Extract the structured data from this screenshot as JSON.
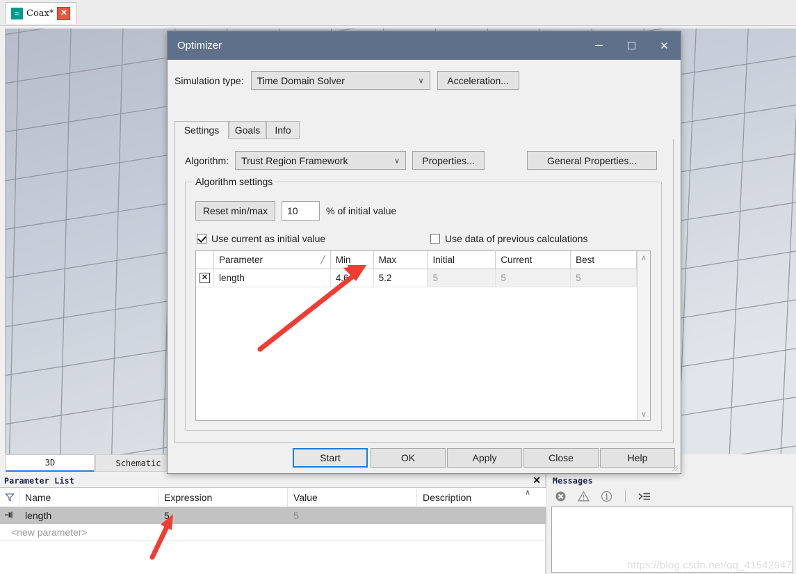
{
  "app": {
    "tab_label": "Coax*",
    "doc_icon": "waves-icon",
    "close_label": "✕"
  },
  "view_tabs": {
    "items": [
      {
        "label": "3D",
        "active": true
      },
      {
        "label": "Schematic",
        "active": false
      }
    ]
  },
  "dialog": {
    "title": "Optimizer",
    "minimize_label": "─",
    "maximize_label": "☐",
    "close_label": "✕",
    "simulation_type": {
      "label": "Simulation type:",
      "value": "Time Domain Solver",
      "caret": "∨"
    },
    "acceleration_button": "Acceleration...",
    "tabs": [
      {
        "label": "Settings",
        "active": true
      },
      {
        "label": "Goals",
        "active": false
      },
      {
        "label": "Info",
        "active": false
      }
    ],
    "algorithm": {
      "label": "Algorithm:",
      "value": "Trust Region Framework",
      "caret": "∨",
      "properties_button": "Properties...",
      "general_properties_button": "General Properties..."
    },
    "algorithm_settings": {
      "group_title": "Algorithm settings",
      "reset_button": "Reset min/max",
      "percent_value": "10",
      "percent_label": "% of initial value",
      "use_current_as_initial": {
        "label": "Use current as initial value",
        "checked": true
      },
      "use_previous_data": {
        "label": "Use data of previous calculations",
        "checked": false
      },
      "grid": {
        "columns": [
          "",
          "Parameter",
          "Min",
          "Max",
          "Initial",
          "Current",
          "Best"
        ],
        "sort_indicator": "╱",
        "rows": [
          {
            "enabled": true,
            "check_mark": "✕",
            "parameter": "length",
            "min": "4.6",
            "max": "5.2",
            "initial": "5",
            "current": "5",
            "best": "5"
          }
        ],
        "scroll_up": "∧",
        "scroll_down": "∨"
      }
    },
    "actions": [
      {
        "label": "Start",
        "default": true
      },
      {
        "label": "OK",
        "default": false
      },
      {
        "label": "Apply",
        "default": false
      },
      {
        "label": "Close",
        "default": false
      },
      {
        "label": "Help",
        "default": false
      }
    ]
  },
  "parameter_list": {
    "caption": "Parameter List",
    "close_label": "✕",
    "filter_icon": "filter-funnel-icon",
    "columns": [
      "Name",
      "Expression",
      "Value",
      "Description"
    ],
    "sort_caret": "∧",
    "rows": [
      {
        "pin_icon": "pin-icon",
        "name": "length",
        "expression": "5",
        "value": "5",
        "description": "",
        "selected": true
      }
    ],
    "new_row_label": "<new parameter>"
  },
  "messages": {
    "caption": "Messages",
    "toolbar_icons": [
      "error-icon",
      "warning-icon",
      "info-icon",
      "clear-list-icon"
    ],
    "body_text": ""
  },
  "watermark": "https://blog.csdn.net/qq_41542947",
  "colors": {
    "dialog_titlebar": "#5f718a",
    "accent_blue": "#1b7fd4",
    "doc_icon_teal": "#009a8e",
    "tab_close_red": "#e8573f",
    "annotation_red": "#f03c32",
    "selected_row": "#c2c2c2"
  },
  "annotations": {
    "arrow_1": "arrow pointing to Min/Max cells in optimizer grid",
    "arrow_2": "arrow pointing to Expression value in parameter list"
  }
}
